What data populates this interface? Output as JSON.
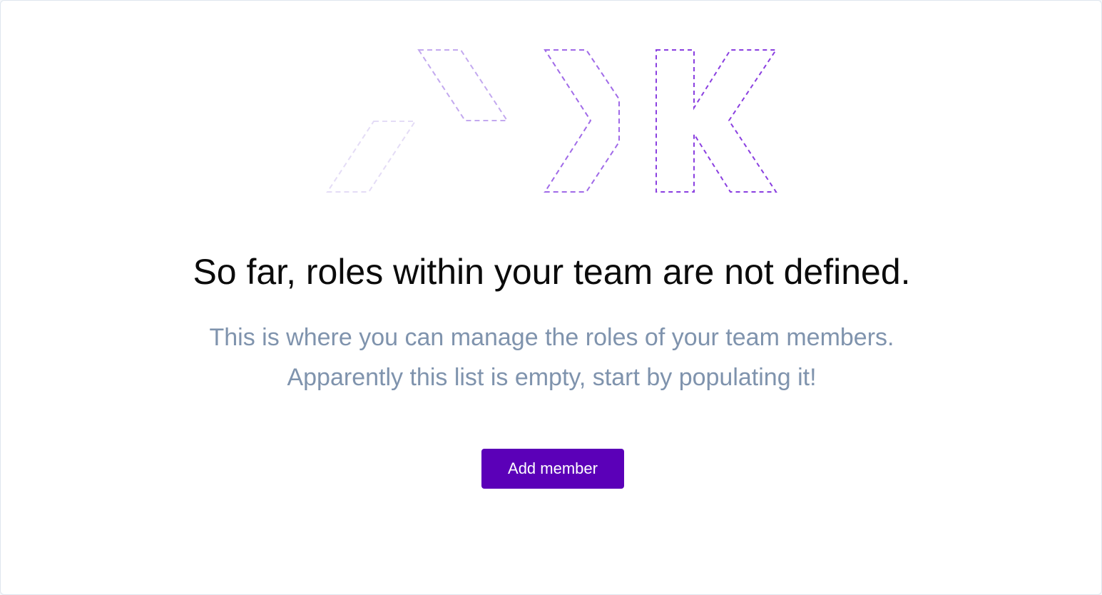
{
  "empty_state": {
    "illustration_icon": "brand-logo-dashed-outline-icon",
    "title": "So far, roles within your team are not defined.",
    "description_line_1": "This is where you can manage the roles of your team members.",
    "description_line_2": "Apparently this list is empty, start by populating it!",
    "primary_action_label": "Add member"
  },
  "colors": {
    "background": "#ffffff",
    "title_text": "#0b0b0b",
    "description_text": "#7f93ad",
    "accent": "#5b00b8",
    "button_text": "#ffffff",
    "illustration_light": "#e4dcf6",
    "illustration_mid": "#c3a9ef",
    "illustration_strong": "#a06ae8",
    "illustration_dark": "#8a3fe0"
  }
}
